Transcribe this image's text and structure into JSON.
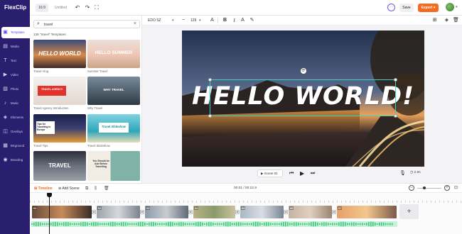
{
  "header": {
    "logo": "FlexClip",
    "ratio": "16:9",
    "project_title": "Untitled",
    "save_label": "Save",
    "export_label": "Export",
    "colors": {
      "nav_bg": "#2a1e6e",
      "accent": "#5a48d8",
      "export": "#f56a1e"
    }
  },
  "nav": {
    "items": [
      {
        "label": "Templates",
        "icon": "templates-icon",
        "active": true
      },
      {
        "label": "Media",
        "icon": "media-icon"
      },
      {
        "label": "Text",
        "icon": "text-icon"
      },
      {
        "label": "Video",
        "icon": "video-icon"
      },
      {
        "label": "Photo",
        "icon": "photo-icon"
      },
      {
        "label": "Music",
        "icon": "music-icon"
      },
      {
        "label": "Elements",
        "icon": "elements-icon"
      },
      {
        "label": "Overlays",
        "icon": "overlays-icon"
      },
      {
        "label": "BKground",
        "icon": "background-icon"
      },
      {
        "label": "Branding",
        "icon": "branding-icon"
      }
    ]
  },
  "templates": {
    "search_value": "travel",
    "count_text": "136 \"travel\" Templates",
    "items": [
      {
        "title": "Travel Vlog",
        "overlay": "HELLO WORLD"
      },
      {
        "title": "Summer Travel",
        "overlay": "HELLO SUMMER"
      },
      {
        "title": "Travel Agency Introduction",
        "overlay": "TRAVEL AGENCY"
      },
      {
        "title": "Why Travel",
        "overlay": "WHY TRAVEL"
      },
      {
        "title": "Travel Tips",
        "overlay": "Tips for Travelling in Europe"
      },
      {
        "title": "Travel Slideshow",
        "overlay": "Travel Slideshow"
      },
      {
        "title": "",
        "overlay": "TRAVEL"
      },
      {
        "title": "",
        "overlay": "You Should be Ask Before Travelling"
      }
    ]
  },
  "toolbar": {
    "font": "EDO SZ",
    "font_size": "129"
  },
  "canvas": {
    "text": "HELLO WORLD!"
  },
  "playback": {
    "scene_label": "Scene 01",
    "duration": "2.9s"
  },
  "timeline": {
    "timeline_label": "Timeline",
    "add_scene_label": "Add Scene",
    "timecode": "00:01 / 00:22.9",
    "zoom_level": 0.3,
    "clips": [
      "01",
      "02",
      "03",
      "04",
      "05",
      "06",
      "07",
      "08"
    ]
  }
}
